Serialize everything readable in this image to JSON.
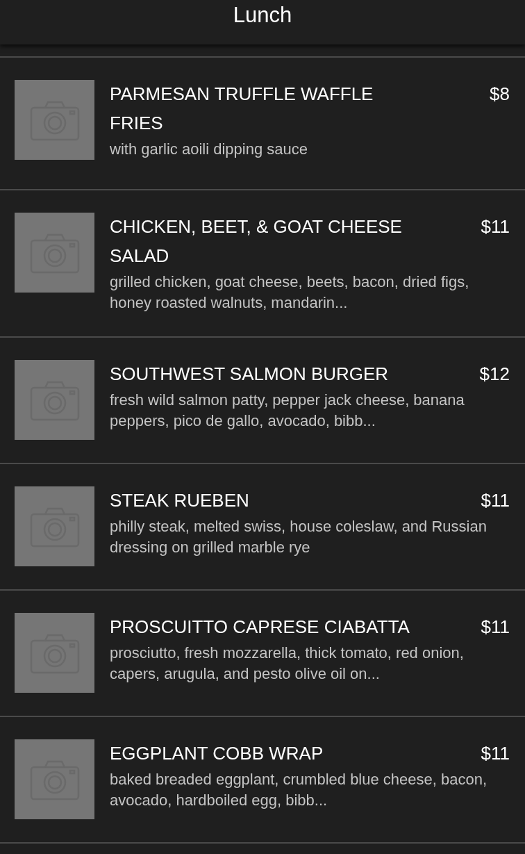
{
  "header": {
    "title": "Lunch"
  },
  "items": [
    {
      "name": "PARMESAN TRUFFLE WAFFLE FRIES",
      "price": "$8",
      "description": "with garlic aoili dipping sauce"
    },
    {
      "name": "CHICKEN, BEET, & GOAT CHEESE SALAD",
      "price": "$11",
      "description": "grilled chicken, goat cheese, beets, bacon, dried figs, honey roasted walnuts, mandarin..."
    },
    {
      "name": "SOUTHWEST SALMON BURGER",
      "price": "$12",
      "description": "fresh wild salmon patty, pepper jack cheese, banana peppers, pico de gallo, avocado, bibb..."
    },
    {
      "name": "STEAK RUEBEN",
      "price": "$11",
      "description": "philly steak, melted swiss, house coleslaw, and Russian dressing on grilled marble rye"
    },
    {
      "name": "PROSCUITTO CAPRESE CIABATTA",
      "price": "$11",
      "description": "prosciutto, fresh mozzarella, thick tomato, red onion, capers, arugula, and pesto olive oil on..."
    },
    {
      "name": "EGGPLANT COBB WRAP",
      "price": "$11",
      "description": "baked breaded eggplant, crumbled blue cheese, bacon, avocado, hardboiled egg, bibb..."
    }
  ]
}
